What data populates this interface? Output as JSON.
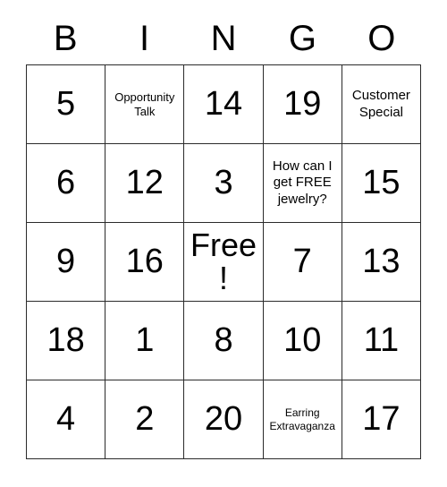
{
  "card": {
    "columns": [
      "B",
      "I",
      "N",
      "G",
      "O"
    ],
    "rows": [
      [
        {
          "text": "5",
          "size": "num"
        },
        {
          "text": "Opportunity Talk",
          "size": "sm"
        },
        {
          "text": "14",
          "size": "num"
        },
        {
          "text": "19",
          "size": "num"
        },
        {
          "text": "Customer Special",
          "size": "md"
        }
      ],
      [
        {
          "text": "6",
          "size": "num"
        },
        {
          "text": "12",
          "size": "num"
        },
        {
          "text": "3",
          "size": "num"
        },
        {
          "text": "How can I get FREE jewelry?",
          "size": "md"
        },
        {
          "text": "15",
          "size": "num"
        }
      ],
      [
        {
          "text": "9",
          "size": "num"
        },
        {
          "text": "16",
          "size": "num"
        },
        {
          "text": "Free!",
          "size": "free"
        },
        {
          "text": "7",
          "size": "num"
        },
        {
          "text": "13",
          "size": "num"
        }
      ],
      [
        {
          "text": "18",
          "size": "num"
        },
        {
          "text": "1",
          "size": "num"
        },
        {
          "text": "8",
          "size": "num"
        },
        {
          "text": "10",
          "size": "num"
        },
        {
          "text": "11",
          "size": "num"
        }
      ],
      [
        {
          "text": "4",
          "size": "num"
        },
        {
          "text": "2",
          "size": "num"
        },
        {
          "text": "20",
          "size": "num"
        },
        {
          "text": "Earring Extravaganza",
          "size": "xs"
        },
        {
          "text": "17",
          "size": "num"
        }
      ]
    ],
    "colors": {
      "border": "#2b2b2b",
      "text": "#000000",
      "background": "#ffffff"
    }
  }
}
